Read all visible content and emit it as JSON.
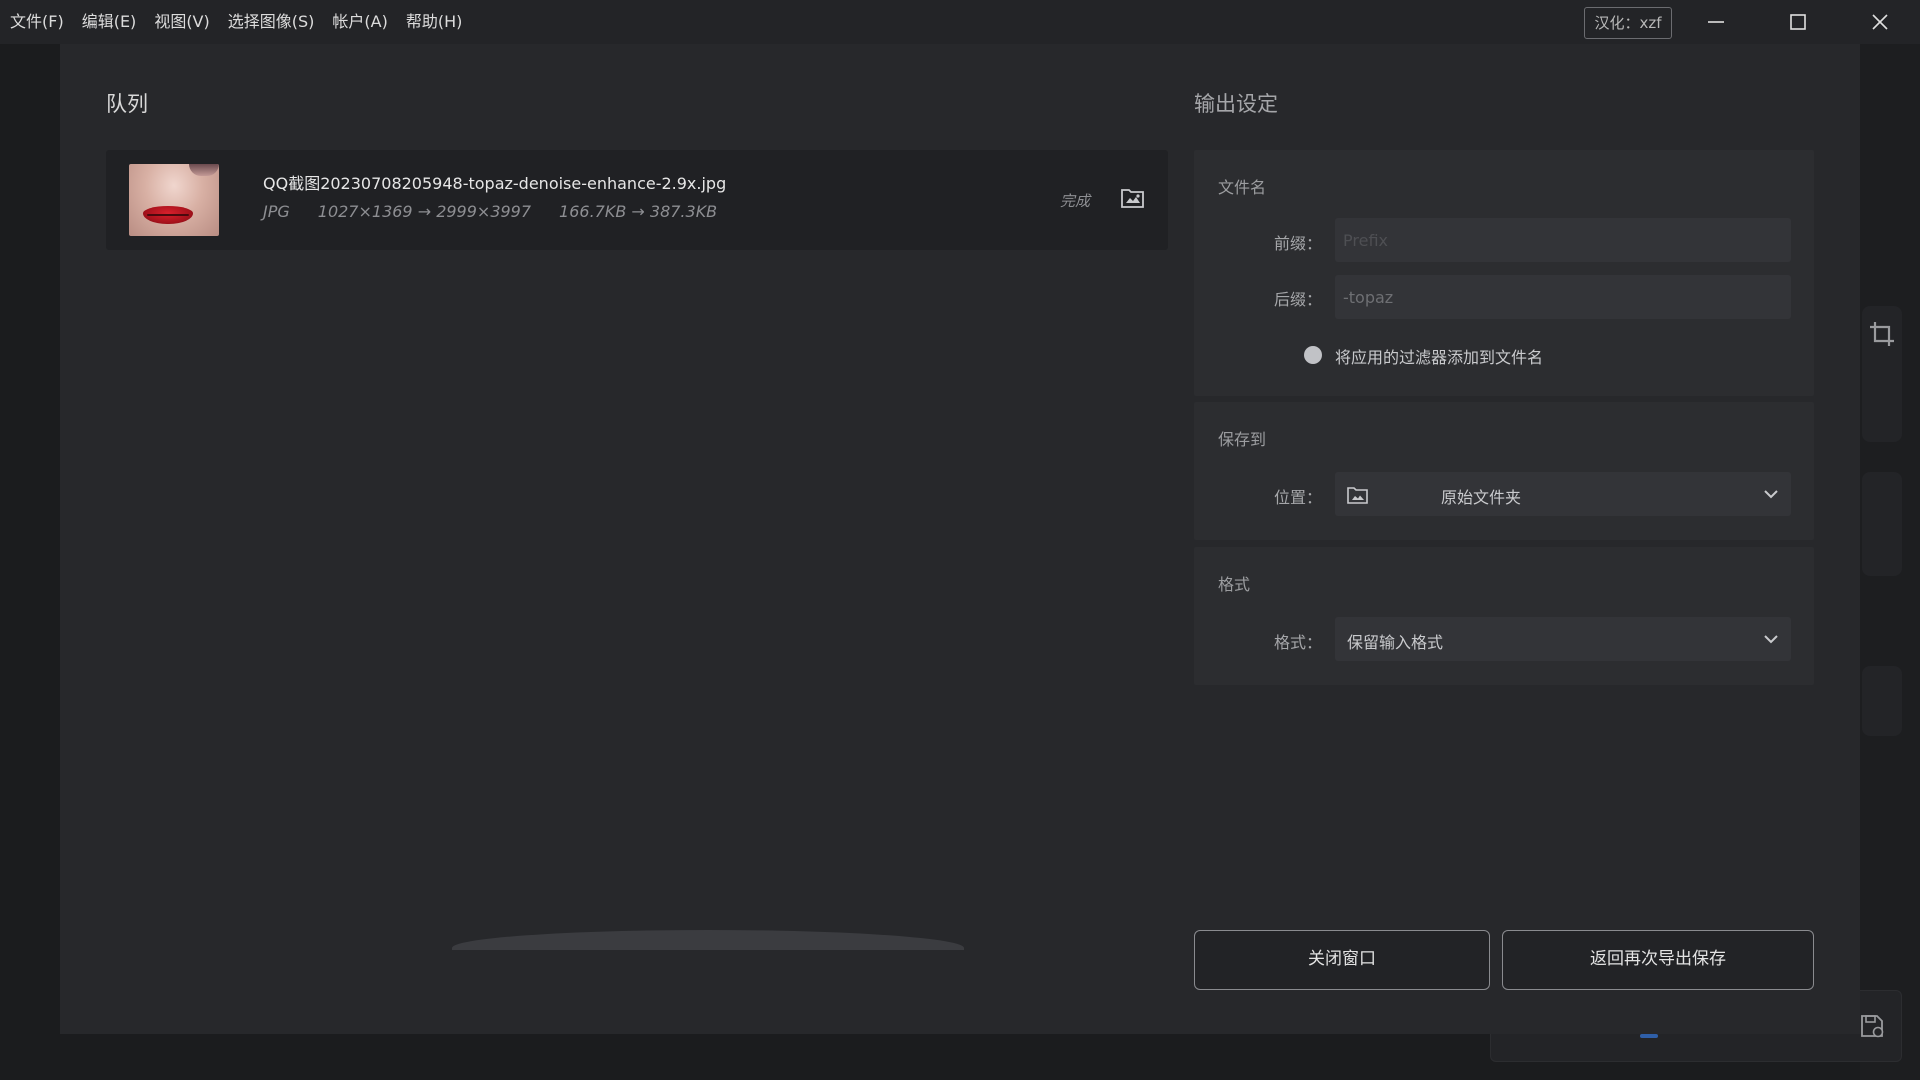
{
  "menubar": {
    "items": [
      "文件(F)",
      "编辑(E)",
      "视图(V)",
      "选择图像(S)",
      "帐户(A)",
      "帮助(H)"
    ],
    "localization_badge": "汉化：xzf"
  },
  "queue": {
    "title": "队列",
    "items": [
      {
        "file_name": "QQ截图20230708205948-topaz-denoise-enhance-2.9x.jpg",
        "format": "JPG",
        "dimensions": "1027×1369 → 2999×3997",
        "size": "166.7KB → 387.3KB",
        "status": "完成",
        "thumbnail_icon": "lips-photo-thumbnail"
      }
    ]
  },
  "output_settings": {
    "title": "输出设定",
    "filename": {
      "label": "文件名",
      "prefix_label": "前缀：",
      "prefix_value": "",
      "prefix_placeholder": "Prefix",
      "suffix_label": "后缀：",
      "suffix_value": "-topaz",
      "add_filters_label": "将应用的过滤器添加到文件名"
    },
    "save_to": {
      "label": "保存到",
      "location_label": "位置：",
      "location_value": "原始文件夹",
      "location_icon": "folder-image-icon"
    },
    "format": {
      "label": "格式",
      "format_label": "格式：",
      "format_value": "保留输入格式"
    }
  },
  "buttons": {
    "close_window": "关闭窗口",
    "return_export": "返回再次导出保存"
  },
  "colors": {
    "background": "#1b1c1e",
    "dialog": "#27282b",
    "panel": "#2c2d30",
    "input": "#333438",
    "titlebar": "#232427"
  }
}
